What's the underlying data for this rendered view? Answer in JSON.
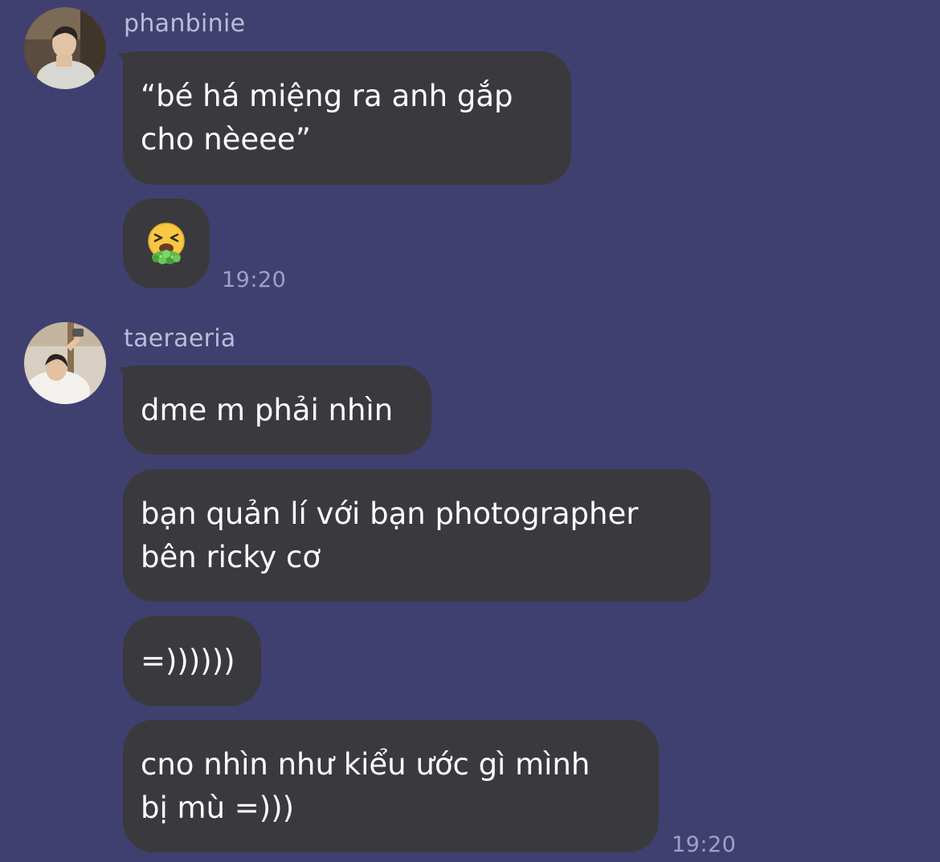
{
  "messages": [
    {
      "username": "phanbinie",
      "avatar": "user-avatar-photo",
      "bubbles": [
        {
          "lines": [
            "“bé há miệng ra anh gắp",
            "cho nèeee”"
          ]
        },
        {
          "emoji": "vomiting-face-icon"
        }
      ],
      "time": "19:20"
    },
    {
      "username": "taeraeria",
      "avatar": "user-avatar-photo",
      "bubbles": [
        {
          "lines": [
            "dme m phải nhìn"
          ]
        },
        {
          "lines": [
            "bạn quản lí với bạn photographer",
            "bên ricky cơ"
          ]
        },
        {
          "lines": [
            "=))))))"
          ]
        },
        {
          "lines": [
            "cno nhìn như kiểu ước gì mình",
            "bị mù =)))"
          ]
        }
      ],
      "time": "19:20"
    }
  ],
  "colors": {
    "background": "#404070",
    "bubble": "#3a3a3e",
    "username": "#b9bdd8",
    "timestamp": "#9ea2c4",
    "text": "#ffffff"
  }
}
